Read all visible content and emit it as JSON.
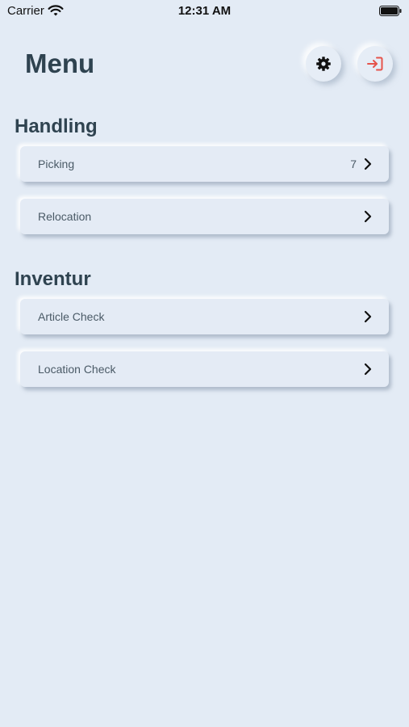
{
  "status_bar": {
    "carrier": "Carrier",
    "time": "12:31 AM"
  },
  "header": {
    "title": "Menu",
    "settings_icon": "gear-icon",
    "logout_icon": "login-arrow-icon",
    "logout_color": "#e5534b"
  },
  "sections": [
    {
      "title": "Handling",
      "items": [
        {
          "label": "Picking",
          "count": "7"
        },
        {
          "label": "Relocation",
          "count": ""
        }
      ]
    },
    {
      "title": "Inventur",
      "items": [
        {
          "label": "Article Check",
          "count": ""
        },
        {
          "label": "Location Check",
          "count": ""
        }
      ]
    }
  ],
  "colors": {
    "background": "#e3ebf5",
    "text": "#2f4350"
  }
}
